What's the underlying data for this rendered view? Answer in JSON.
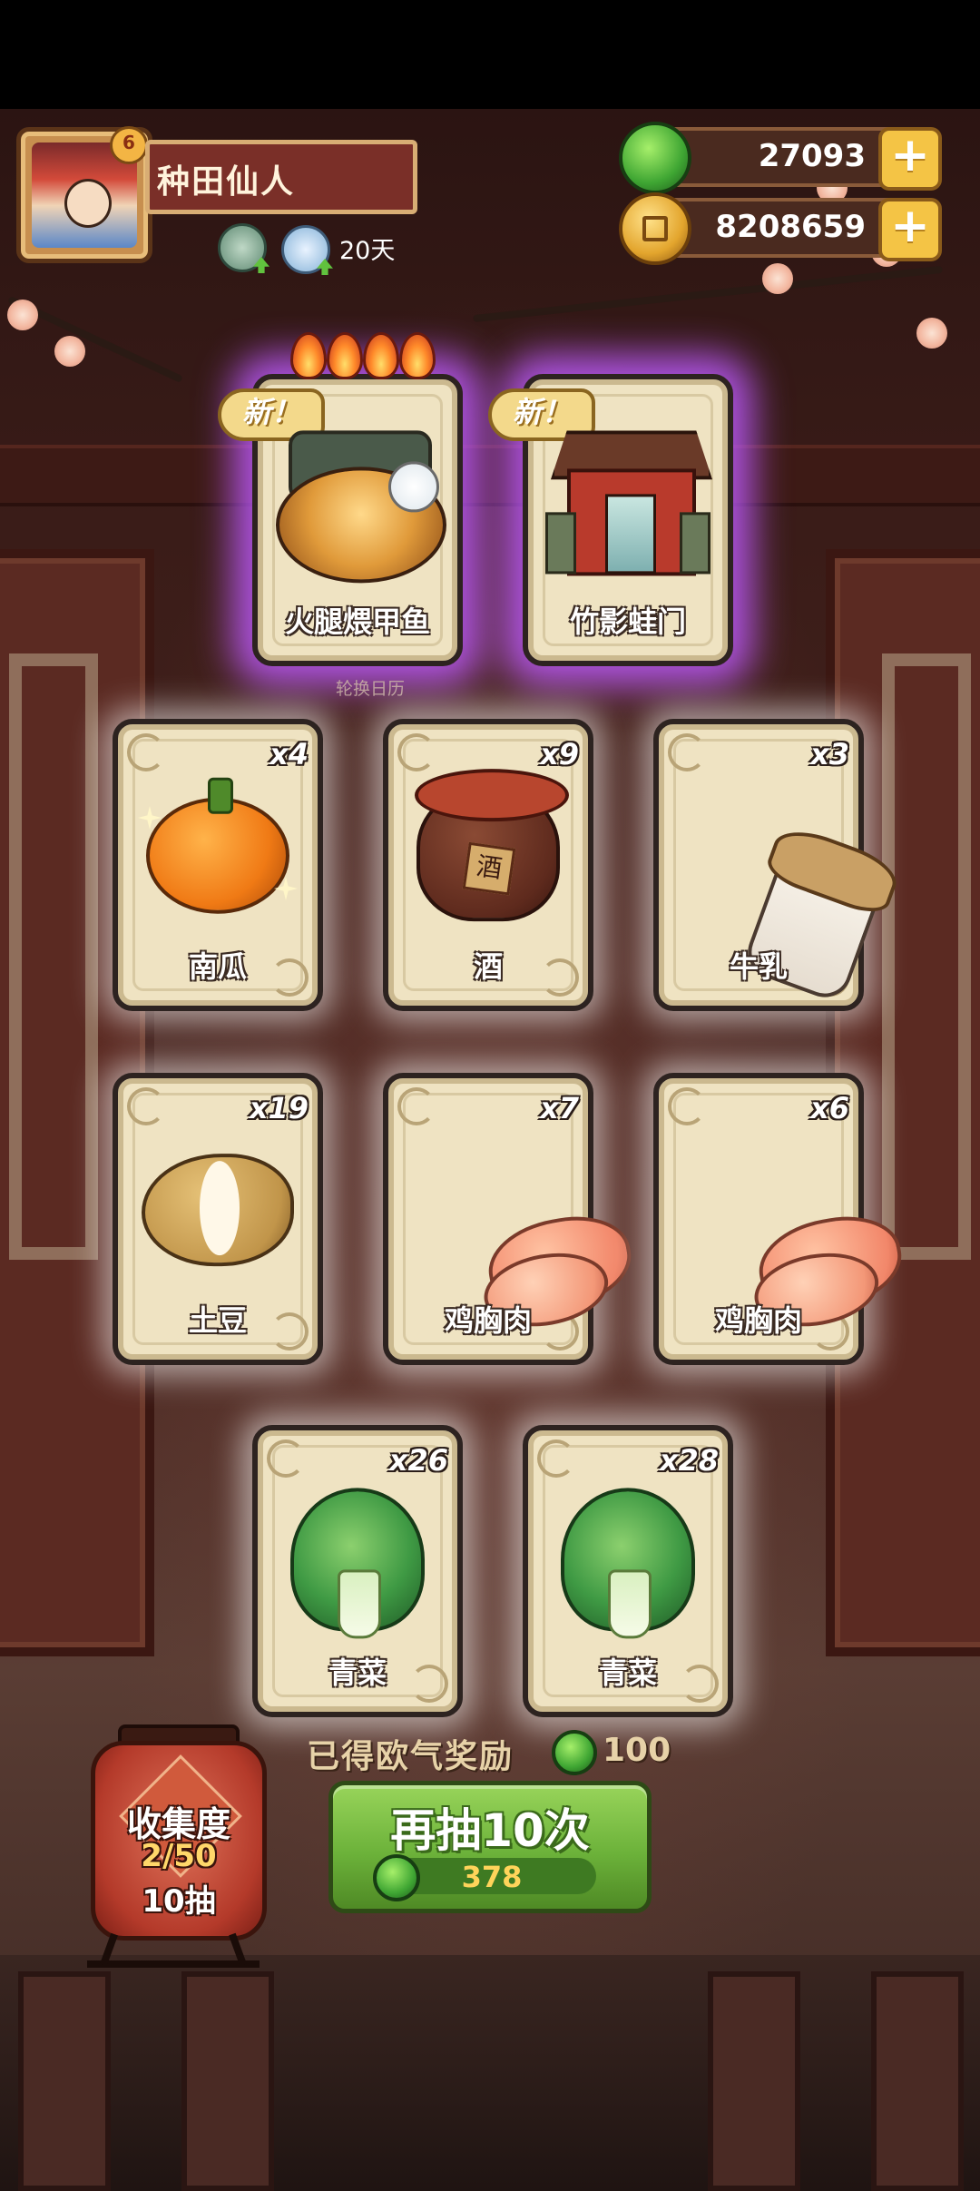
{
  "player": {
    "name": "种田仙人",
    "rank_badge": "6",
    "days": "20天"
  },
  "currencies": {
    "jade": "27093",
    "coins": "8208659",
    "plus": "+"
  },
  "featured_cards": [
    {
      "name": "火腿煨甲鱼",
      "new_tag": "新！",
      "flames": 4
    },
    {
      "name": "竹影蛙门",
      "new_tag": "新！",
      "flames": 0
    }
  ],
  "calendar_text": "轮换日历",
  "cards": [
    {
      "name": "南瓜",
      "count": "x4"
    },
    {
      "name": "酒",
      "count": "x9"
    },
    {
      "name": "牛乳",
      "count": "x3"
    },
    {
      "name": "土豆",
      "count": "x19"
    },
    {
      "name": "鸡胸肉",
      "count": "x7"
    },
    {
      "name": "鸡胸肉",
      "count": "x6"
    },
    {
      "name": "青菜",
      "count": "x26"
    },
    {
      "name": "青菜",
      "count": "x28"
    }
  ],
  "reward": {
    "label": "已得欧气奖励",
    "value": "100"
  },
  "draw_button": {
    "label": "再抽10次",
    "cost": "378"
  },
  "collection": {
    "title": "收集度",
    "progress": "2/50",
    "sub": "10抽"
  },
  "colors": {
    "glow_featured": "#be5aff",
    "glow_normal": "#ffffff",
    "button_green": "#6cb23a",
    "lantern_red": "#b43a2a"
  }
}
